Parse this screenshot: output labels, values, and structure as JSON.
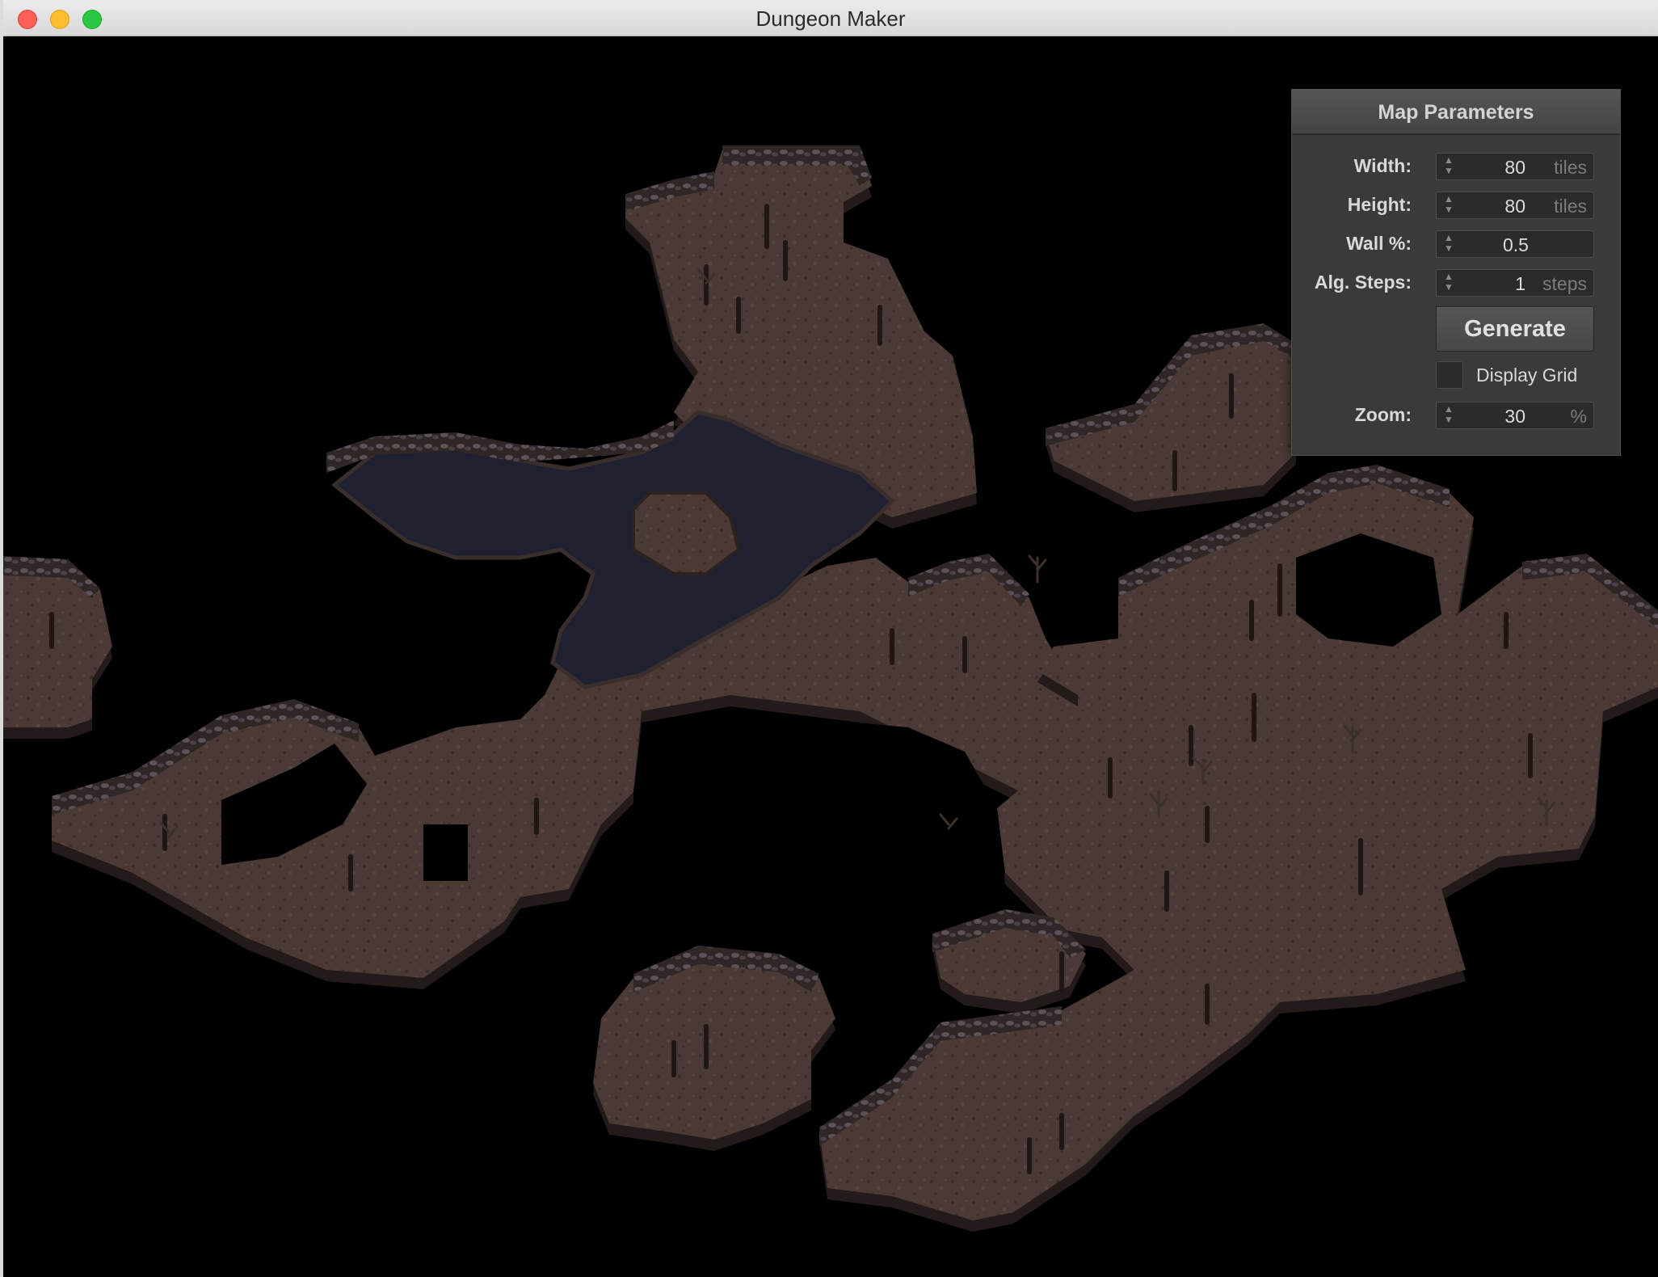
{
  "window": {
    "title": "Dungeon Maker"
  },
  "panel": {
    "title": "Map Parameters",
    "fields": {
      "width": {
        "label": "Width:",
        "value": "80",
        "unit": "tiles"
      },
      "height": {
        "label": "Height:",
        "value": "80",
        "unit": "tiles"
      },
      "wall": {
        "label": "Wall %:",
        "value": "0.5",
        "unit": ""
      },
      "steps": {
        "label": "Alg. Steps:",
        "value": "1",
        "unit": "steps"
      },
      "zoom": {
        "label": "Zoom:",
        "value": "30",
        "unit": "%"
      }
    },
    "generate_label": "Generate",
    "display_grid": {
      "label": "Display Grid",
      "checked": false
    }
  },
  "colors": {
    "floor": "#4a3934",
    "floor_dark": "#3a2c28",
    "water": "#1e1f2b",
    "wall": "#2e2624",
    "wall_top": "#6a5a5a",
    "background": "#000000"
  }
}
